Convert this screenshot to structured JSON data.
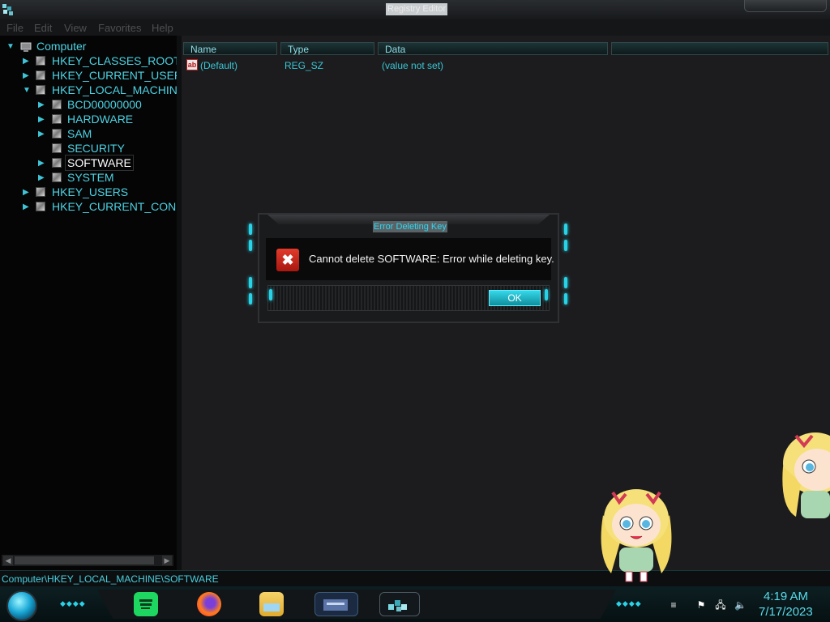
{
  "window": {
    "title": "Registry Editor"
  },
  "menu": [
    "File",
    "Edit",
    "View",
    "Favorites",
    "Help"
  ],
  "tree": {
    "root": "Computer",
    "items": [
      {
        "label": "HKEY_CLASSES_ROOT"
      },
      {
        "label": "HKEY_CURRENT_USER"
      },
      {
        "label": "HKEY_LOCAL_MACHINE"
      },
      {
        "label": "BCD00000000"
      },
      {
        "label": "HARDWARE"
      },
      {
        "label": "SAM"
      },
      {
        "label": "SECURITY"
      },
      {
        "label": "SOFTWARE"
      },
      {
        "label": "SYSTEM"
      },
      {
        "label": "HKEY_USERS"
      },
      {
        "label": "HKEY_CURRENT_CONFI"
      }
    ]
  },
  "list": {
    "columns": [
      "Name",
      "Type",
      "Data"
    ],
    "rows": [
      {
        "name": "(Default)",
        "type": "REG_SZ",
        "data": "(value not set)",
        "icon": "ab"
      }
    ]
  },
  "status": {
    "path": "Computer\\HKEY_LOCAL_MACHINE\\SOFTWARE"
  },
  "dialog": {
    "title": "Error Deleting Key",
    "message": "Cannot delete SOFTWARE:  Error while deleting key.",
    "ok_label": "OK",
    "icon": "error-icon"
  },
  "taskbar": {
    "apps": [
      "spotify-icon",
      "firefox-icon",
      "file-explorer-icon",
      "media-app-icon",
      "registry-editor-icon"
    ],
    "clock_time": "4:19 AM",
    "clock_date": "7/17/2023"
  },
  "colors": {
    "accent": "#2bd3e6",
    "error": "#d42a1f",
    "background": "#1c1c1e"
  }
}
